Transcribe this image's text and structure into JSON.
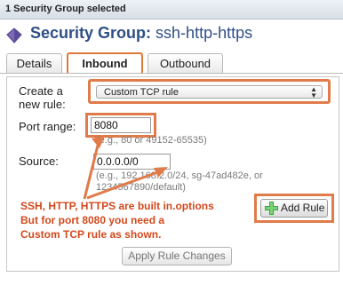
{
  "header": {
    "selection_text": "1 Security Group selected"
  },
  "security_group": {
    "title_prefix": "Security Group:",
    "name": "ssh-http-https"
  },
  "tabs": [
    {
      "label": "Details",
      "active": false
    },
    {
      "label": "Inbound",
      "active": true
    },
    {
      "label": "Outbound",
      "active": false
    }
  ],
  "form": {
    "create_rule_label_line1": "Create a",
    "create_rule_label_line2": "new rule:",
    "rule_select_value": "Custom TCP rule",
    "port_range_label": "Port range:",
    "port_range_value": "8080",
    "port_range_hint": "(e.g., 80 or 49152-65535)",
    "source_label": "Source:",
    "source_value": "0.0.0.0/0",
    "source_hint_line1": "(e.g., 192.168.2.0/24, sg-47ad482e, or",
    "source_hint_line2": "1234567890/default)",
    "add_rule_label": "Add Rule",
    "apply_label": "Apply Rule Changes"
  },
  "annotation": {
    "line1": "SSH, HTTP, HTTPS are built in.options",
    "line2": "But for port 8080 you need a",
    "line3": "Custom TCP rule as shown."
  },
  "colors": {
    "highlight": "#e07b4a",
    "annotation_text": "#d2491d",
    "title_blue": "#2f4f86",
    "add_icon_green": "#3ca63c"
  },
  "icons": {
    "security_group": "shield-icon",
    "select_arrows": "updown-arrows-icon",
    "add": "plus-icon"
  }
}
